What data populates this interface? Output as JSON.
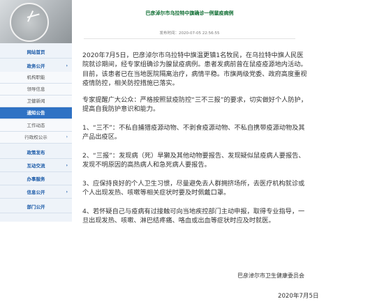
{
  "sidebar": {
    "items": [
      {
        "label": "网站首页",
        "has_arrow": false,
        "type": "main"
      },
      {
        "label": "政务公开",
        "has_arrow": true,
        "type": "main"
      },
      {
        "label": "机构职能",
        "has_arrow": false,
        "type": "sub"
      },
      {
        "label": "领导信息",
        "has_arrow": false,
        "type": "sub"
      },
      {
        "label": "卫健新闻",
        "has_arrow": false,
        "type": "sub"
      },
      {
        "label": "通知公告",
        "has_arrow": false,
        "type": "active"
      },
      {
        "label": "工作动态",
        "has_arrow": false,
        "type": "sub"
      },
      {
        "label": "行政权公示",
        "has_arrow": true,
        "type": "sub"
      },
      {
        "label": "政策发布",
        "has_arrow": false,
        "type": "main"
      },
      {
        "label": "互动交流",
        "has_arrow": true,
        "type": "main"
      },
      {
        "label": "办事服务",
        "has_arrow": false,
        "type": "main"
      },
      {
        "label": "信息公开",
        "has_arrow": true,
        "type": "main"
      },
      {
        "label": "部门公开",
        "has_arrow": false,
        "type": "main"
      }
    ]
  },
  "article": {
    "title": "巴彦淖尔市乌拉特中旗确诊一例鼠疫病例",
    "meta": "发布时间：2020-07-05 22:56:55",
    "paragraphs": [
      "2020年7月5日，巴彦淖尔市乌拉特中旗温更镇1名牧民，在乌拉特中旗人民医院就诊期间，经专家组确诊为腺鼠疫病例。患者发病前曾在鼠疫疫源地内活动。目前，该患者已在当地医院隔离治疗，病情平稳。市旗两级党委、政府高度重视疫情防控，相关防控措施已落实。",
      "专家提醒广大公众：严格按照鼠疫防控“三不三报”的要求，切实做好个人防护，提高自我防护意识和能力。",
      "1、“三不”：不私自捕猎疫源动物、不剥食疫源动物、不私自携带疫源动物及其产品出疫区。",
      "2、“三报”：发现病（死）旱獭及其他动物要报告、发现疑似鼠疫病人要报告、发现不明原因的高热病人和急死病人要报告。",
      "3、应保持良好的个人卫生习惯，尽量避免去人群拥挤场所，去医疗机构就诊或个人出现发热、咳嗽等相关症状时要及时佩戴口罩。",
      "4、若怀疑自己与疫病有过接触可向当地疾控部门主动申报，取得专业指导，一旦出现发热、咳嗽、淋巴结疼痛、咯血或出血等症状时应及时就医。"
    ],
    "org": "巴彦淖尔市卫生健康委员会",
    "date": "2020年7月5日"
  },
  "colors": {
    "active_nav": "#2f72c4",
    "title": "#0b6b2f",
    "nav_text": "#1a5aa8"
  },
  "icons": {
    "nav_arrow": "chevron-right-icon"
  }
}
